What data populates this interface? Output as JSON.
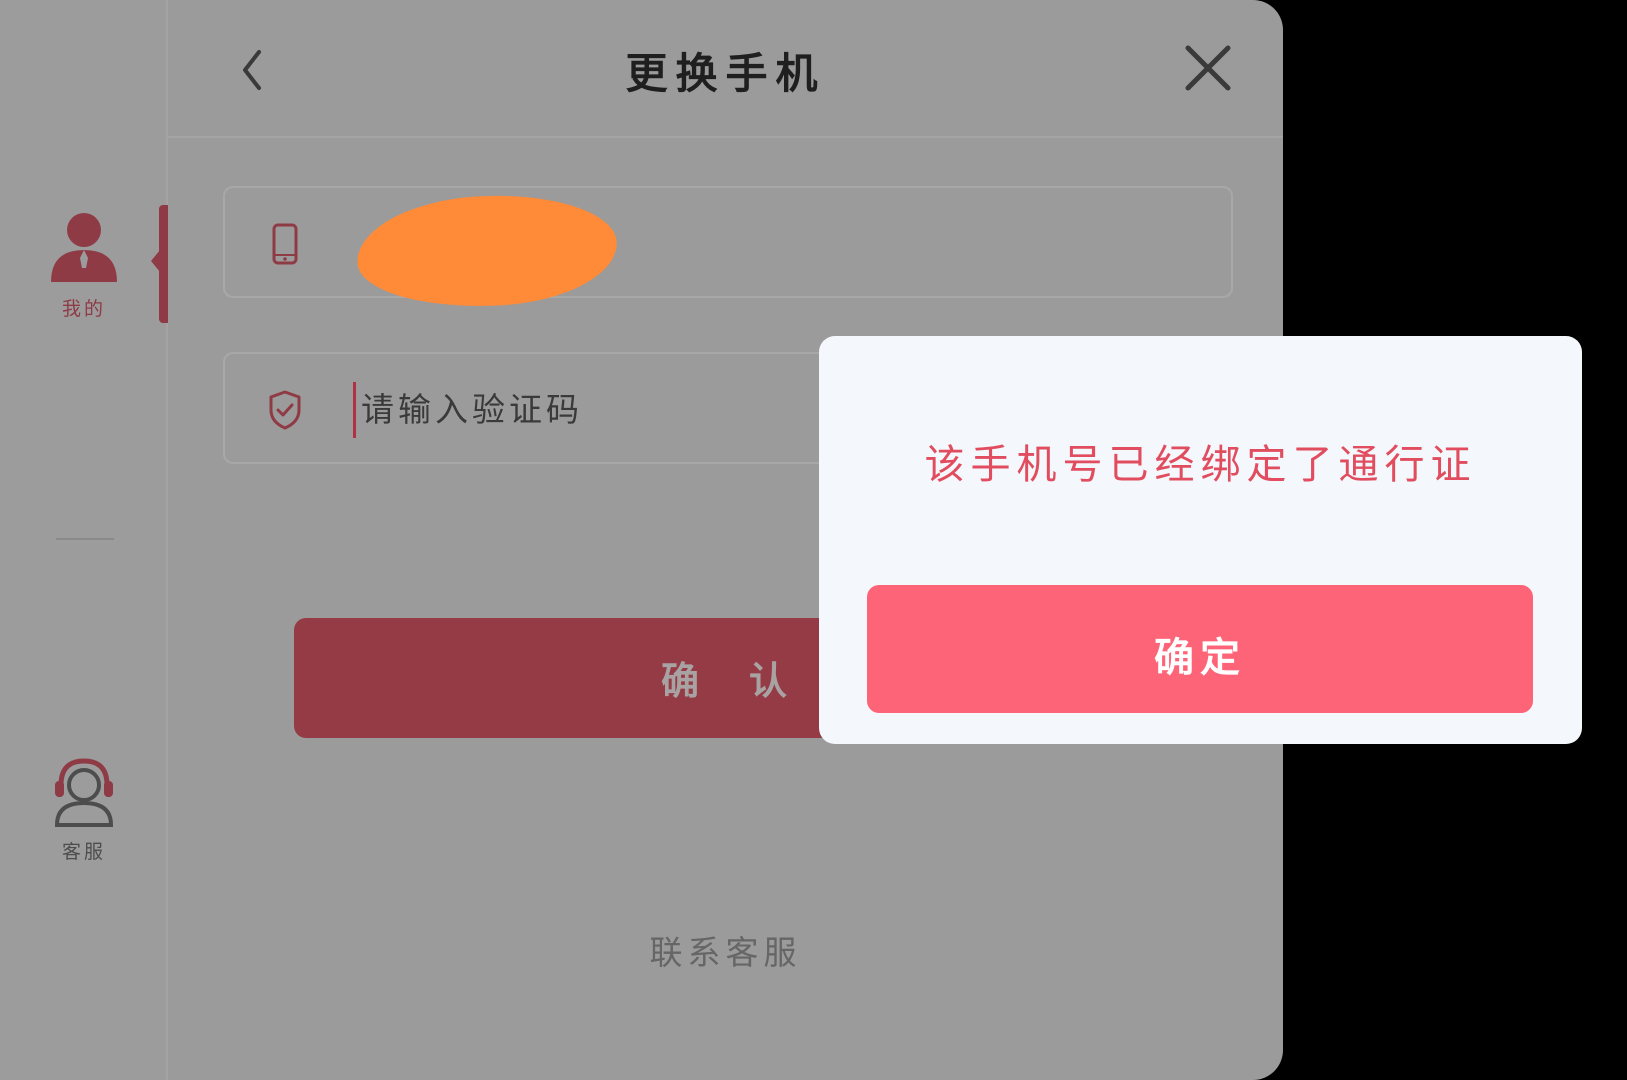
{
  "sidebar": {
    "items": [
      {
        "label": "我的",
        "icon": "user-icon",
        "active": true
      },
      {
        "label": "客服",
        "icon": "headset-user-icon",
        "active": false
      }
    ]
  },
  "header": {
    "title": "更换手机",
    "back_icon": "chevron-left-icon",
    "close_icon": "close-icon"
  },
  "form": {
    "phone_icon": "phone-icon",
    "phone_value_redacted": true,
    "code_icon": "shield-check-icon",
    "code_placeholder": "请输入验证码",
    "confirm_label": "确认"
  },
  "footer": {
    "contact_label": "联系客服"
  },
  "dialog": {
    "message": "该手机号已经绑定了通行证",
    "ok_label": "确定"
  },
  "colors": {
    "accent": "#fe6477",
    "message": "#e14d5f",
    "redaction": "#ff8a38",
    "dim_button": "#943b45"
  }
}
